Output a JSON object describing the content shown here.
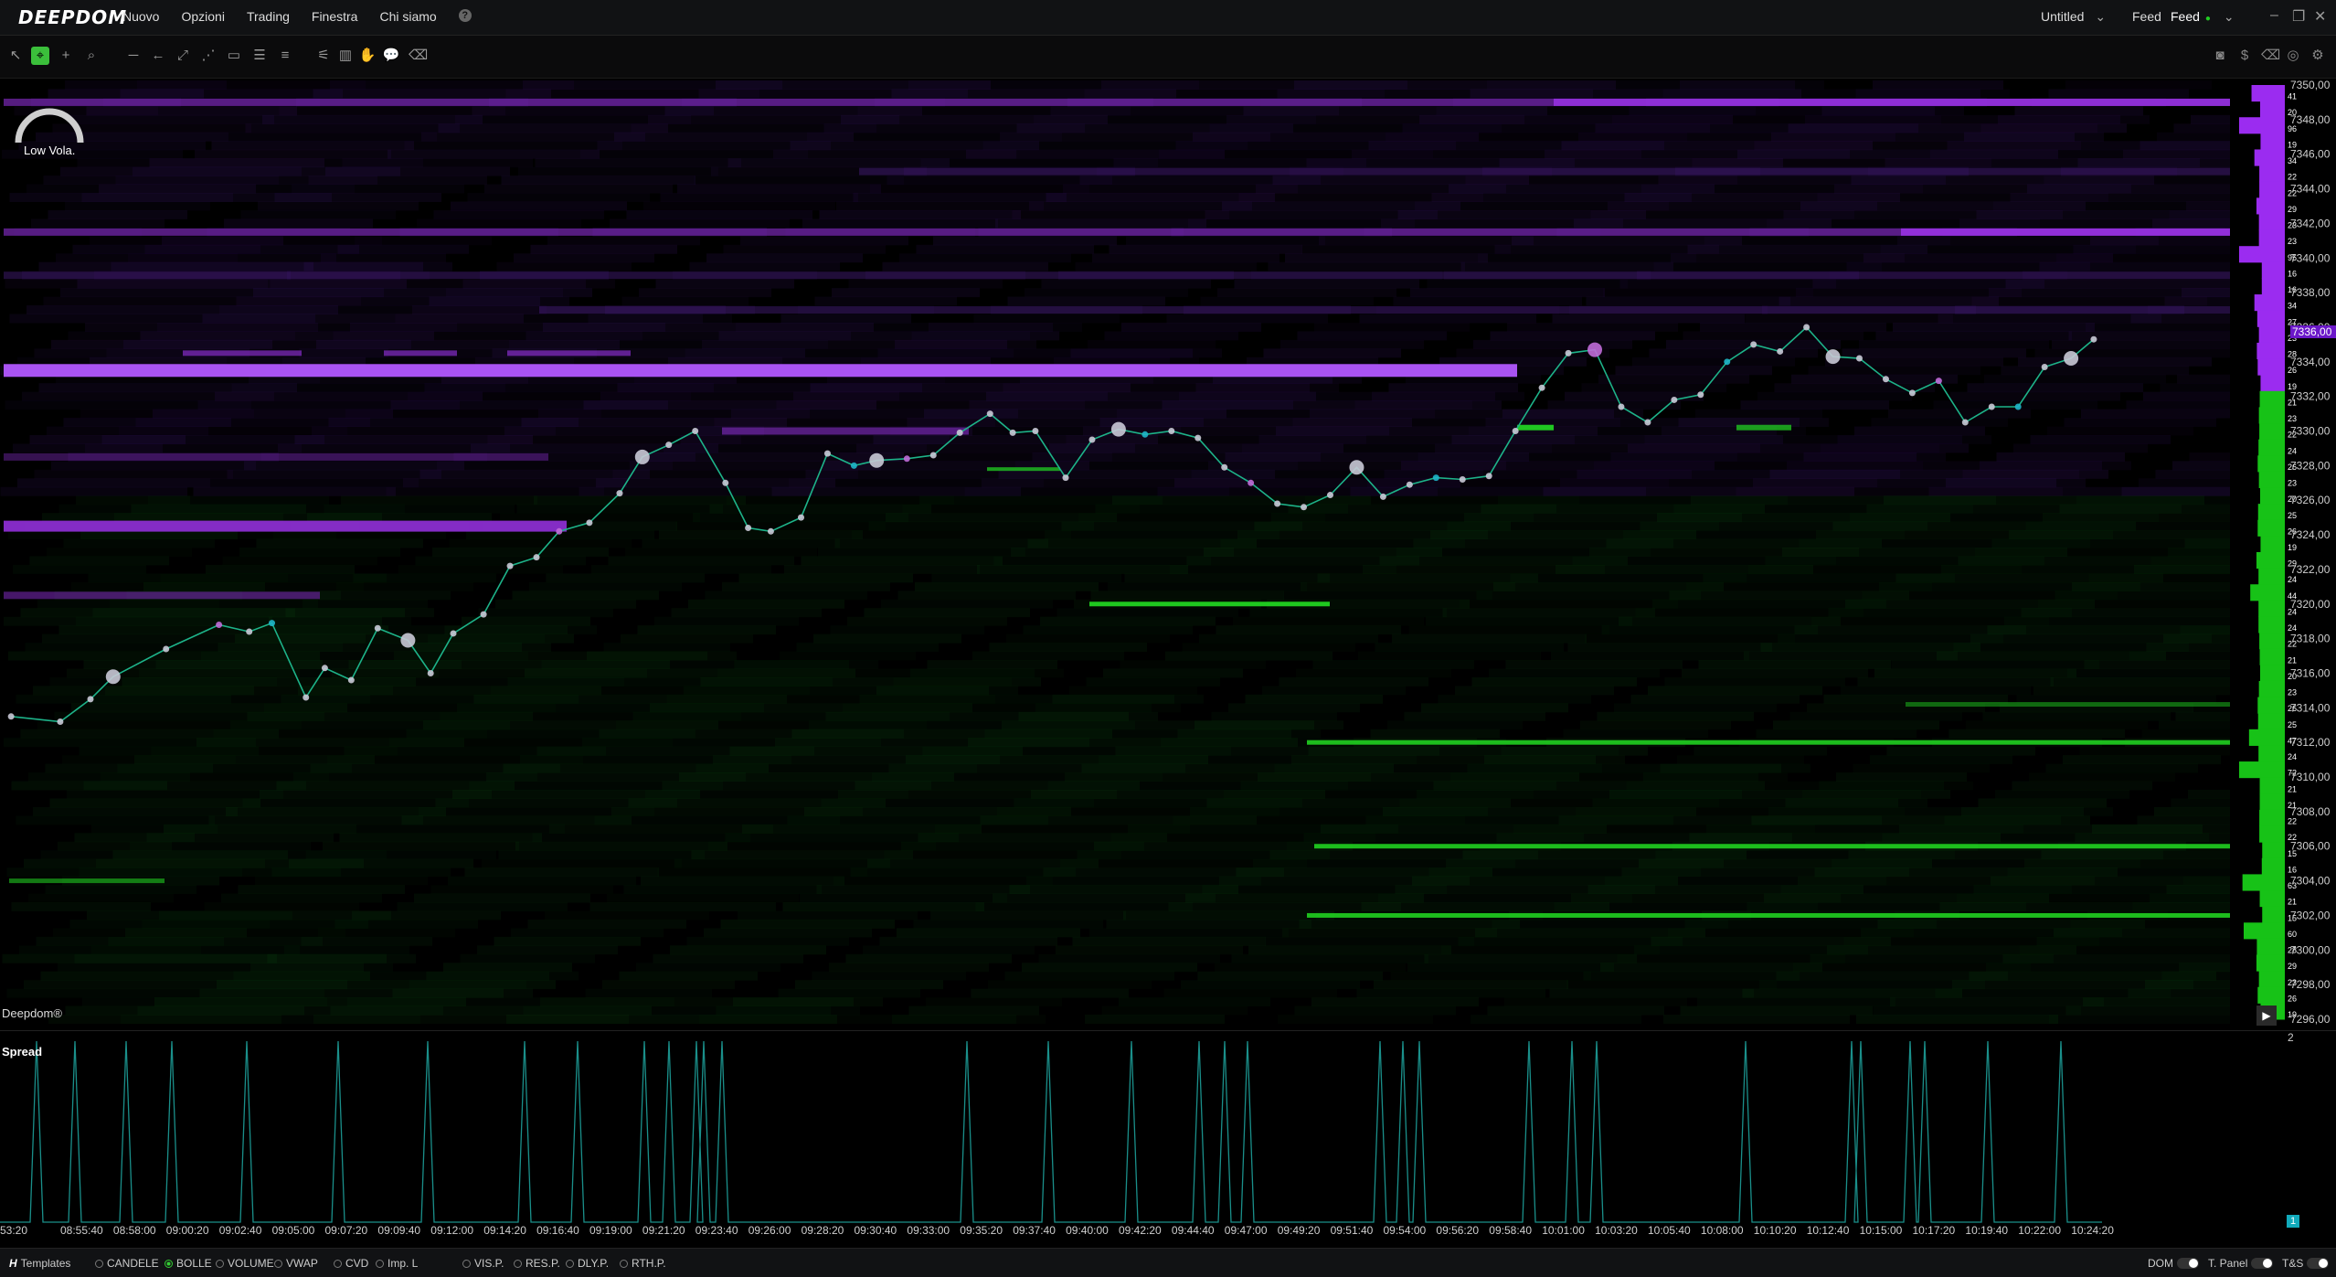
{
  "app": {
    "logo": "DEEPDOM",
    "menu": [
      "Nuovo",
      "Opzioni",
      "Trading",
      "Finestra",
      "Chi siamo"
    ],
    "workspace": "Untitled",
    "feed_label": "Feed",
    "feed_button": "Feed"
  },
  "toolbar": {
    "left_tools": [
      "pointer-icon",
      "crosshair-icon",
      "plus-icon",
      "zoom-icon",
      "hline-icon",
      "ray-icon",
      "trendline-icon",
      "channel-icon",
      "rectangle-icon",
      "fib-icon",
      "levels-icon",
      "settings-sliders-icon",
      "histogram-icon",
      "footprint-icon",
      "comment-icon",
      "eraser-icon"
    ],
    "right_tools": [
      "camera-icon",
      "dollar-icon",
      "eraser-icon",
      "target-icon",
      "gear-icon"
    ]
  },
  "chart": {
    "volatility_label": "Low Vola.",
    "watermark": "Deepdom®",
    "current_price": "7336,00",
    "colors": {
      "ask": "#9b33e8",
      "bid": "#22dd22",
      "price_line": "#1db389"
    },
    "y_labels": [
      "7350,00",
      "7348,00",
      "7346,00",
      "7344,00",
      "7342,00",
      "7340,00",
      "7338,00",
      "7336,00",
      "7334,00",
      "7332,00",
      "7330,00",
      "7328,00",
      "7326,00",
      "7324,00",
      "7322,00",
      "7320,00",
      "7318,00",
      "7316,00",
      "7314,00",
      "7312,00",
      "7310,00",
      "7308,00",
      "7306,00",
      "7304,00",
      "7302,00",
      "7300,00",
      "7298,00",
      "7296,00"
    ],
    "dom_sizes": [
      "41",
      "20",
      "96",
      "19",
      "34",
      "22",
      "22",
      "29",
      "23",
      "23",
      "95",
      "16",
      "16",
      "34",
      "27",
      "23",
      "28",
      "26",
      "19",
      "21",
      "23",
      "22",
      "24",
      "26",
      "23",
      "20",
      "25",
      "26",
      "19",
      "29",
      "24",
      "44",
      "24",
      "24",
      "22",
      "21",
      "20",
      "23",
      "26",
      "25",
      "47",
      "24",
      "72",
      "21",
      "21",
      "22",
      "22",
      "15",
      "16",
      "63",
      "21",
      "15",
      "60",
      "28",
      "29",
      "23",
      "26",
      "19"
    ],
    "x_labels": [
      "53:20",
      "08:55:40",
      "08:58:00",
      "09:00:20",
      "09:02:40",
      "09:05:00",
      "09:07:20",
      "09:09:40",
      "09:12:00",
      "09:14:20",
      "09:16:40",
      "09:19:00",
      "09:21:20",
      "09:23:40",
      "09:26:00",
      "09:28:20",
      "09:30:40",
      "09:33:00",
      "09:35:20",
      "09:37:40",
      "09:40:00",
      "09:42:20",
      "09:44:40",
      "09:47:00",
      "09:49:20",
      "09:51:40",
      "09:54:00",
      "09:56:20",
      "09:58:40",
      "10:01:00",
      "10:03:20",
      "10:05:40",
      "10:08:00",
      "10:10:20",
      "10:12:40",
      "10:15:00",
      "10:17:20",
      "10:19:40",
      "10:22:00",
      "10:24:20"
    ]
  },
  "chart_data": {
    "type": "line",
    "title": "",
    "xlabel": "",
    "ylabel": "",
    "ylim": [
      7295.5,
      7351
    ],
    "series": [
      {
        "x": [
          "08:53:30",
          "08:55:40",
          "08:57:00",
          "08:58:00",
          "09:00:20",
          "09:02:40",
          "09:04:00",
          "09:05:00",
          "09:06:30",
          "09:07:20",
          "09:08:30",
          "09:09:40",
          "09:11:00",
          "09:12:00",
          "09:13:00",
          "09:14:20",
          "09:15:30",
          "09:16:40",
          "09:17:40",
          "09:19:00",
          "09:20:20",
          "09:21:20",
          "09:22:30",
          "09:23:40",
          "09:25:00",
          "09:26:00",
          "09:27:00",
          "09:28:20",
          "09:29:30",
          "09:30:40",
          "09:31:40",
          "09:33:00",
          "09:34:10",
          "09:35:20",
          "09:36:40",
          "09:37:40",
          "09:38:40",
          "09:40:00",
          "09:41:10",
          "09:42:20",
          "09:43:30",
          "09:44:40",
          "09:45:50",
          "09:47:00",
          "09:48:10",
          "09:49:20",
          "09:50:30",
          "09:51:40",
          "09:52:50",
          "09:54:00",
          "09:55:10",
          "09:56:20",
          "09:57:30",
          "09:58:40",
          "09:59:50",
          "10:01:00",
          "10:02:10",
          "10:03:20",
          "10:04:30",
          "10:05:40",
          "10:06:50",
          "10:08:00",
          "10:09:10",
          "10:10:20",
          "10:11:30",
          "10:12:40",
          "10:13:50",
          "10:15:00",
          "10:16:10",
          "10:17:20",
          "10:18:30",
          "10:19:40",
          "10:20:50",
          "10:22:00",
          "10:23:10",
          "10:24:20",
          "10:25:20"
        ],
        "values": [
          7313.5,
          7313.2,
          7314.5,
          7315.8,
          7317.4,
          7318.8,
          7318.4,
          7318.9,
          7314.6,
          7316.3,
          7315.6,
          7318.6,
          7317.9,
          7316.0,
          7318.3,
          7319.4,
          7322.2,
          7322.7,
          7324.2,
          7324.7,
          7326.4,
          7328.5,
          7329.2,
          7330.0,
          7327.0,
          7324.4,
          7324.2,
          7325.0,
          7328.7,
          7328.0,
          7328.3,
          7328.4,
          7328.6,
          7329.9,
          7331.0,
          7329.9,
          7330.0,
          7327.3,
          7329.5,
          7330.1,
          7329.8,
          7330.0,
          7329.6,
          7327.9,
          7327.0,
          7325.8,
          7325.6,
          7326.3,
          7327.9,
          7326.2,
          7326.9,
          7327.3,
          7327.2,
          7327.4,
          7330.0,
          7332.5,
          7334.5,
          7334.7,
          7331.4,
          7330.5,
          7331.8,
          7332.1,
          7334.0,
          7335.0,
          7334.6,
          7336.0,
          7334.3,
          7334.2,
          7333.0,
          7332.2,
          7332.9,
          7330.5,
          7331.4,
          7331.4,
          7333.7,
          7334.2,
          7335.3
        ]
      }
    ]
  },
  "subchart": {
    "title": "Spread",
    "max_label": "2",
    "current_value": "1"
  },
  "bottom": {
    "templates_label": "Templates",
    "indicators": [
      {
        "label": "CANDELE",
        "on": false
      },
      {
        "label": "BOLLE",
        "on": true
      },
      {
        "label": "VOLUME",
        "on": false
      },
      {
        "label": "VWAP",
        "on": false
      },
      {
        "label": "CVD",
        "on": false
      },
      {
        "label": "Imp. L",
        "on": false
      },
      {
        "label": "VIS.P.",
        "on": false
      },
      {
        "label": "RES.P.",
        "on": false
      },
      {
        "label": "DLY.P.",
        "on": false
      },
      {
        "label": "RTH.P.",
        "on": false
      }
    ],
    "dom_label": "DOM",
    "tpanel_label": "T. Panel",
    "ts_label": "T&S"
  }
}
